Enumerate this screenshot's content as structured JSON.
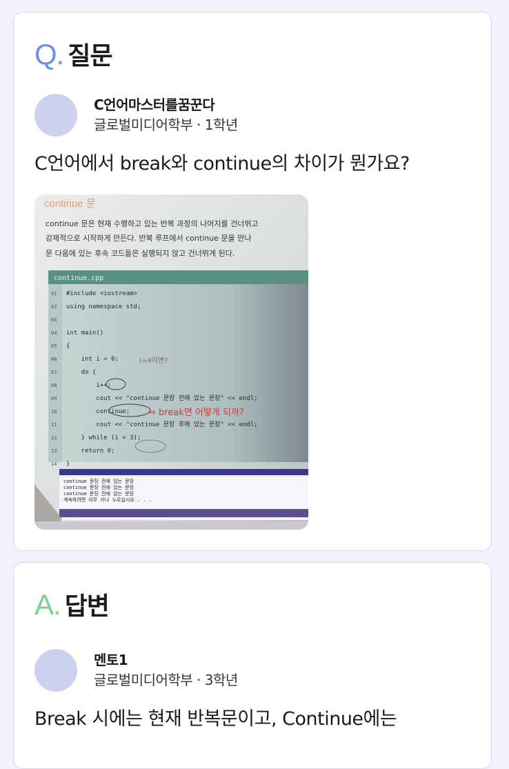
{
  "question": {
    "letter": "Q.",
    "title": "질문",
    "letter_color": "#6f8fe0",
    "author": {
      "name": "C언어마스터를꿈꾼다",
      "meta": "글로벌미디어학부 · 1학년"
    },
    "body": "C언어에서 break와 continue의 차이가 뭔가요?",
    "photo": {
      "heading": "continue 문",
      "desc": [
        "continue 문은 현재 수행하고 있는 반복 과정의 나머지를 건너뛰고",
        "강제적으로 시작하게 만든다. 반복 루프에서 continue 문을 만나",
        "문 다음에 있는 후속 코드들은 실행되지 않고 건너뛰게 된다."
      ],
      "filename": "continue.cpp",
      "line_numbers": [
        "01",
        "02",
        "03",
        "04",
        "05",
        "06",
        "07",
        "08",
        "09",
        "10",
        "11",
        "12",
        "13",
        "14"
      ],
      "code": [
        "#include <iostream>",
        "using namespace std;",
        "",
        "int main()",
        "{",
        "    int i = 0;",
        "    do {",
        "        i++;",
        "        cout << \"continue 문장 전에 있는 문장\" << endl;",
        "        continue;",
        "        cout << \"continue 문장 후에 있는 문장\" << endl;",
        "    } while (i < 3);",
        "    return 0;",
        "}"
      ],
      "handwriting": [
        "i=4이면?",
        "⇒ break면 어떻게 되까?"
      ],
      "console": [
        "continue 문장 전에 있는 문장",
        "continue 문장 전에 있는 문장",
        "continue 문장 전에 있는 문장",
        "계속하려면 아무 키나 누르십시오 . . ."
      ]
    }
  },
  "answer": {
    "letter": "A.",
    "title": "답변",
    "letter_color": "#7fcf8c",
    "author": {
      "name": "멘토1",
      "meta": "글로벌미디어학부 · 3학년"
    },
    "body": "Break 시에는 현재 반복문이고, Continue에는"
  }
}
